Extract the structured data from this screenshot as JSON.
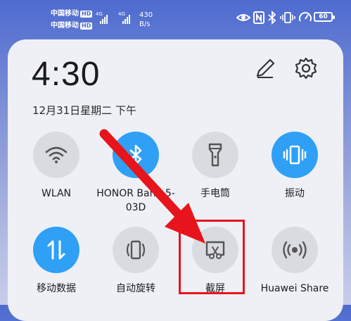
{
  "status_bar": {
    "carrier1": "中国移动",
    "carrier2": "中国移动",
    "hd_badge": "HD",
    "network1": "4G",
    "network2": "4G",
    "speed_value": "430",
    "speed_unit": "B/s",
    "battery": "60",
    "icons": [
      "eye-icon",
      "nfc-icon",
      "bluetooth-icon",
      "vibrate-icon",
      "speedometer-icon"
    ]
  },
  "panel": {
    "time": "4:30",
    "date": "12月31日星期二 下午"
  },
  "tiles": [
    {
      "label": "WLAN",
      "state": "off",
      "icon": "wifi-icon"
    },
    {
      "label": "HONOR Band 5-03D",
      "state": "on",
      "icon": "bluetooth-icon"
    },
    {
      "label": "手电筒",
      "state": "off",
      "icon": "flashlight-icon"
    },
    {
      "label": "振动",
      "state": "on",
      "icon": "vibrate-icon"
    },
    {
      "label": "移动数据",
      "state": "on",
      "icon": "mobile-data-icon"
    },
    {
      "label": "自动旋转",
      "state": "off",
      "icon": "auto-rotate-icon"
    },
    {
      "label": "截屏",
      "state": "off",
      "icon": "screenshot-icon"
    },
    {
      "label": "Huawei Share",
      "state": "off",
      "icon": "huawei-share-icon"
    }
  ],
  "colors": {
    "accent_on": "#2fa0f5",
    "tile_off": "#d9dbe0",
    "annotation_red": "#e8141b"
  }
}
